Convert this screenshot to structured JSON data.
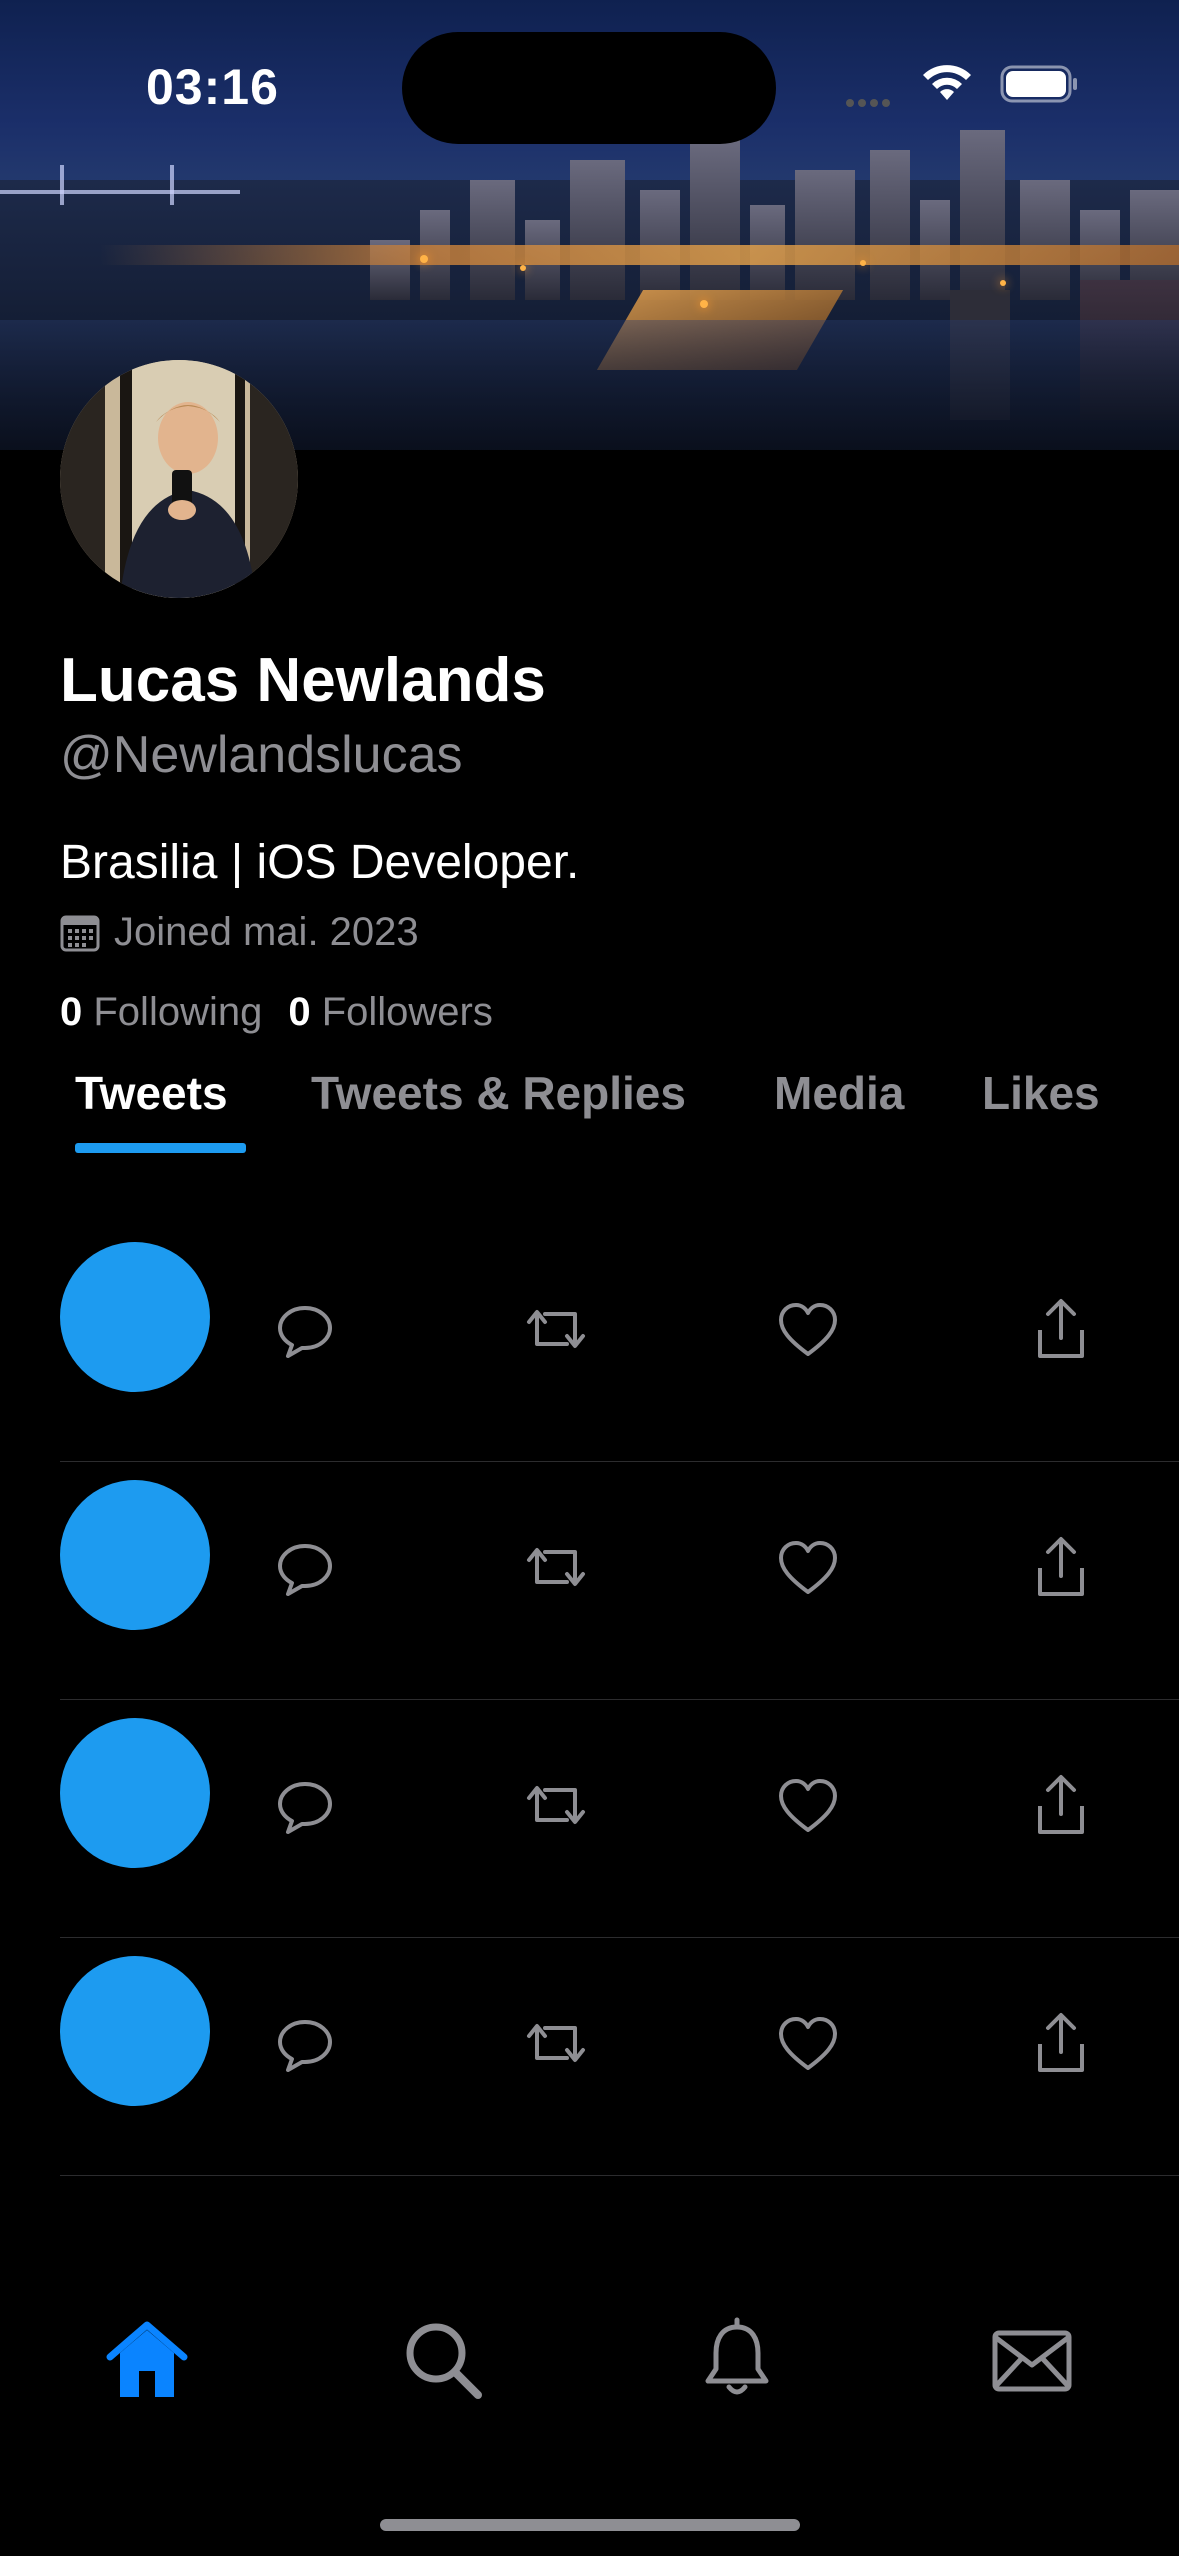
{
  "status_bar": {
    "time": "03:16"
  },
  "profile": {
    "name": "Lucas Newlands",
    "handle": "@Newlandslucas",
    "bio": "Brasilia | iOS Developer.",
    "joined": "Joined mai. 2023",
    "following_count": "0",
    "following_label": "Following",
    "followers_count": "0",
    "followers_label": "Followers"
  },
  "tabs": [
    {
      "label": "Tweets",
      "active": true
    },
    {
      "label": "Tweets & Replies",
      "active": false
    },
    {
      "label": "Media",
      "active": false
    },
    {
      "label": "Likes",
      "active": false
    }
  ],
  "tweet_rows": [
    {
      "actions": [
        "reply-icon",
        "retweet-icon",
        "like-icon",
        "share-icon"
      ]
    },
    {
      "actions": [
        "reply-icon",
        "retweet-icon",
        "like-icon",
        "share-icon"
      ]
    },
    {
      "actions": [
        "reply-icon",
        "retweet-icon",
        "like-icon",
        "share-icon"
      ]
    },
    {
      "actions": [
        "reply-icon",
        "retweet-icon",
        "like-icon",
        "share-icon"
      ]
    }
  ],
  "bottom_nav": [
    {
      "icon": "home-icon",
      "active": true
    },
    {
      "icon": "search-icon",
      "active": false
    },
    {
      "icon": "bell-icon",
      "active": false
    },
    {
      "icon": "mail-icon",
      "active": false
    }
  ],
  "colors": {
    "accent": "#1d9bf0",
    "nav_active": "#0a84ff",
    "secondary_text": "#8e8e93",
    "background": "#000000"
  }
}
